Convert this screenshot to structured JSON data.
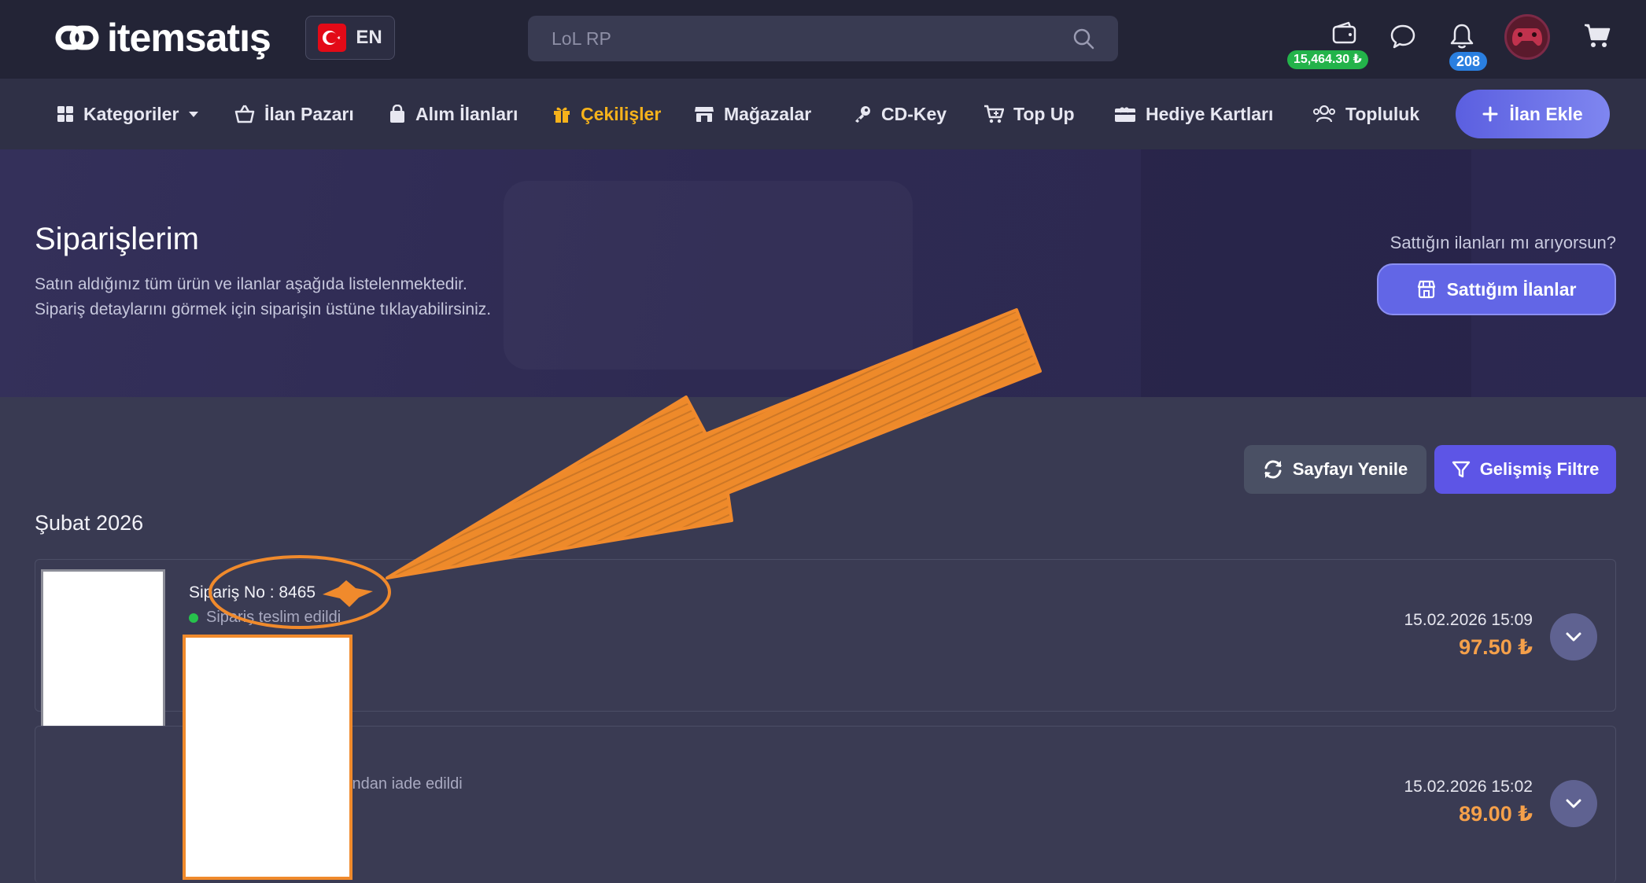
{
  "header": {
    "logo_text": "itemsatış",
    "lang_code": "EN",
    "search_placeholder": "LoL RP",
    "wallet_balance": "15,464.30 ₺",
    "notification_count": "208"
  },
  "nav": {
    "items": [
      {
        "label": "Kategoriler"
      },
      {
        "label": "İlan Pazarı"
      },
      {
        "label": "Alım İlanları"
      },
      {
        "label": "Çekilişler"
      },
      {
        "label": "Mağazalar"
      },
      {
        "label": "CD-Key"
      },
      {
        "label": "Top Up"
      },
      {
        "label": "Hediye Kartları"
      },
      {
        "label": "Topluluk"
      }
    ],
    "add_listing_label": "İlan Ekle"
  },
  "hero": {
    "title": "Siparişlerim",
    "description_line1": "Satın aldığınız tüm ürün ve ilanlar aşağıda listelenmektedir.",
    "description_line2": "Sipariş detaylarını görmek için siparişin üstüne tıklayabilirsiniz.",
    "seller_question": "Sattığın ilanları mı arıyorsun?",
    "seller_button_label": "Sattığım İlanlar"
  },
  "actions": {
    "refresh_label": "Sayfayı Yenile",
    "filter_label": "Gelişmiş Filtre"
  },
  "month_heading": "Şubat 2026",
  "orders": [
    {
      "order_no": "Sipariş No : 8465",
      "status": "Sipariş teslim edildi",
      "date": "15.02.2026 15:09",
      "price": "97.50 ₺"
    },
    {
      "status": "ından iade edildi",
      "date": "15.02.2026 15:02",
      "price": "89.00 ₺"
    }
  ],
  "colors": {
    "accent": "#6266e6",
    "active_nav": "#f6b21b",
    "price": "#f5a04a",
    "annotation": "#f08a2c"
  }
}
